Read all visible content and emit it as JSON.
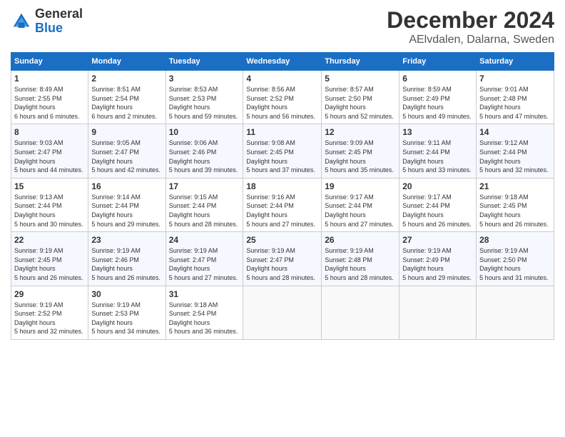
{
  "logo": {
    "general": "General",
    "blue": "Blue"
  },
  "header": {
    "title": "December 2024",
    "subtitle": "AElvdalen, Dalarna, Sweden"
  },
  "weekdays": [
    "Sunday",
    "Monday",
    "Tuesday",
    "Wednesday",
    "Thursday",
    "Friday",
    "Saturday"
  ],
  "weeks": [
    [
      {
        "day": "1",
        "sunrise": "8:49 AM",
        "sunset": "2:55 PM",
        "daylight": "6 hours and 6 minutes."
      },
      {
        "day": "2",
        "sunrise": "8:51 AM",
        "sunset": "2:54 PM",
        "daylight": "6 hours and 2 minutes."
      },
      {
        "day": "3",
        "sunrise": "8:53 AM",
        "sunset": "2:53 PM",
        "daylight": "5 hours and 59 minutes."
      },
      {
        "day": "4",
        "sunrise": "8:56 AM",
        "sunset": "2:52 PM",
        "daylight": "5 hours and 56 minutes."
      },
      {
        "day": "5",
        "sunrise": "8:57 AM",
        "sunset": "2:50 PM",
        "daylight": "5 hours and 52 minutes."
      },
      {
        "day": "6",
        "sunrise": "8:59 AM",
        "sunset": "2:49 PM",
        "daylight": "5 hours and 49 minutes."
      },
      {
        "day": "7",
        "sunrise": "9:01 AM",
        "sunset": "2:48 PM",
        "daylight": "5 hours and 47 minutes."
      }
    ],
    [
      {
        "day": "8",
        "sunrise": "9:03 AM",
        "sunset": "2:47 PM",
        "daylight": "5 hours and 44 minutes."
      },
      {
        "day": "9",
        "sunrise": "9:05 AM",
        "sunset": "2:47 PM",
        "daylight": "5 hours and 42 minutes."
      },
      {
        "day": "10",
        "sunrise": "9:06 AM",
        "sunset": "2:46 PM",
        "daylight": "5 hours and 39 minutes."
      },
      {
        "day": "11",
        "sunrise": "9:08 AM",
        "sunset": "2:45 PM",
        "daylight": "5 hours and 37 minutes."
      },
      {
        "day": "12",
        "sunrise": "9:09 AM",
        "sunset": "2:45 PM",
        "daylight": "5 hours and 35 minutes."
      },
      {
        "day": "13",
        "sunrise": "9:11 AM",
        "sunset": "2:44 PM",
        "daylight": "5 hours and 33 minutes."
      },
      {
        "day": "14",
        "sunrise": "9:12 AM",
        "sunset": "2:44 PM",
        "daylight": "5 hours and 32 minutes."
      }
    ],
    [
      {
        "day": "15",
        "sunrise": "9:13 AM",
        "sunset": "2:44 PM",
        "daylight": "5 hours and 30 minutes."
      },
      {
        "day": "16",
        "sunrise": "9:14 AM",
        "sunset": "2:44 PM",
        "daylight": "5 hours and 29 minutes."
      },
      {
        "day": "17",
        "sunrise": "9:15 AM",
        "sunset": "2:44 PM",
        "daylight": "5 hours and 28 minutes."
      },
      {
        "day": "18",
        "sunrise": "9:16 AM",
        "sunset": "2:44 PM",
        "daylight": "5 hours and 27 minutes."
      },
      {
        "day": "19",
        "sunrise": "9:17 AM",
        "sunset": "2:44 PM",
        "daylight": "5 hours and 27 minutes."
      },
      {
        "day": "20",
        "sunrise": "9:17 AM",
        "sunset": "2:44 PM",
        "daylight": "5 hours and 26 minutes."
      },
      {
        "day": "21",
        "sunrise": "9:18 AM",
        "sunset": "2:45 PM",
        "daylight": "5 hours and 26 minutes."
      }
    ],
    [
      {
        "day": "22",
        "sunrise": "9:19 AM",
        "sunset": "2:45 PM",
        "daylight": "5 hours and 26 minutes."
      },
      {
        "day": "23",
        "sunrise": "9:19 AM",
        "sunset": "2:46 PM",
        "daylight": "5 hours and 26 minutes."
      },
      {
        "day": "24",
        "sunrise": "9:19 AM",
        "sunset": "2:47 PM",
        "daylight": "5 hours and 27 minutes."
      },
      {
        "day": "25",
        "sunrise": "9:19 AM",
        "sunset": "2:47 PM",
        "daylight": "5 hours and 28 minutes."
      },
      {
        "day": "26",
        "sunrise": "9:19 AM",
        "sunset": "2:48 PM",
        "daylight": "5 hours and 28 minutes."
      },
      {
        "day": "27",
        "sunrise": "9:19 AM",
        "sunset": "2:49 PM",
        "daylight": "5 hours and 29 minutes."
      },
      {
        "day": "28",
        "sunrise": "9:19 AM",
        "sunset": "2:50 PM",
        "daylight": "5 hours and 31 minutes."
      }
    ],
    [
      {
        "day": "29",
        "sunrise": "9:19 AM",
        "sunset": "2:52 PM",
        "daylight": "5 hours and 32 minutes."
      },
      {
        "day": "30",
        "sunrise": "9:19 AM",
        "sunset": "2:53 PM",
        "daylight": "5 hours and 34 minutes."
      },
      {
        "day": "31",
        "sunrise": "9:18 AM",
        "sunset": "2:54 PM",
        "daylight": "5 hours and 36 minutes."
      },
      null,
      null,
      null,
      null
    ]
  ],
  "labels": {
    "sunrise": "Sunrise:",
    "sunset": "Sunset:",
    "daylight": "Daylight hours"
  }
}
